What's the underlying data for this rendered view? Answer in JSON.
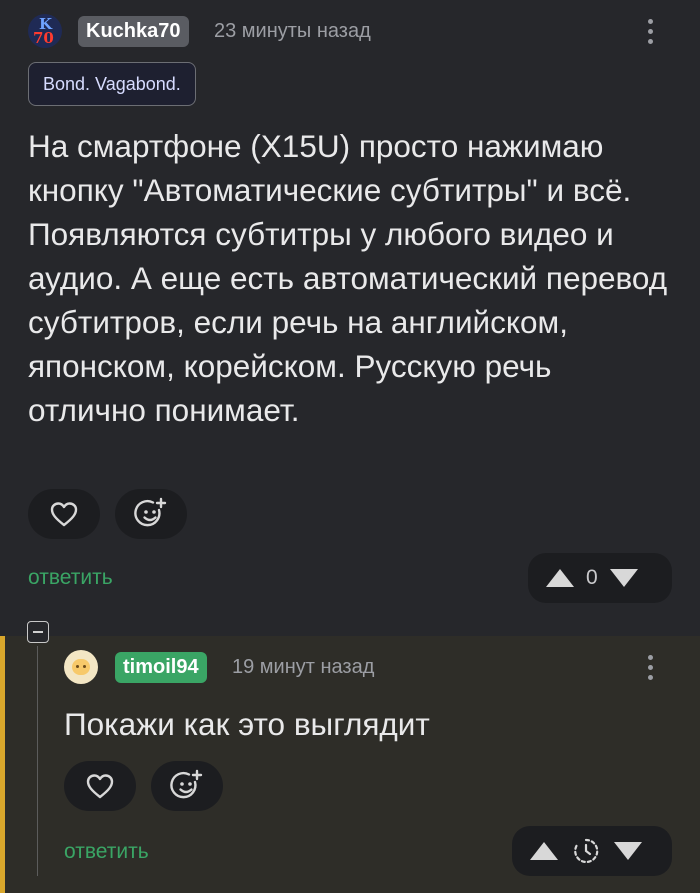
{
  "comment": {
    "author": "Kuchka70",
    "time": "23 минуты назад",
    "tag": "Bond. Vagabond.",
    "text": "На смартфоне (X15U) просто нажимаю кнопку \"Автоматические субтитры\" и всё. Появляются субтитры у любого видео и аудио. А еще есть автоматический перевод субтитров, если речь на английском, японском, корейском. Русскую речь отлично понимает.",
    "reply_label": "ответить",
    "rating": "0",
    "avatar_text": [
      "K",
      "70"
    ]
  },
  "reply": {
    "author": "timoil94",
    "time": "19 минут назад",
    "text": "Покажи как это выглядит",
    "reply_label": "ответить"
  },
  "icons": {
    "like": "heart-icon",
    "react": "emoji-add-icon",
    "upvote": "triangle-up-icon",
    "downvote": "triangle-down-icon",
    "pending": "clock-icon",
    "menu": "kebab-icon",
    "collapse": "minus-square-icon"
  },
  "colors": {
    "background": "#26272b",
    "thread_background": "#2e2d28",
    "accent_green": "#3aa565",
    "thread_bar": "#d9a72c"
  }
}
